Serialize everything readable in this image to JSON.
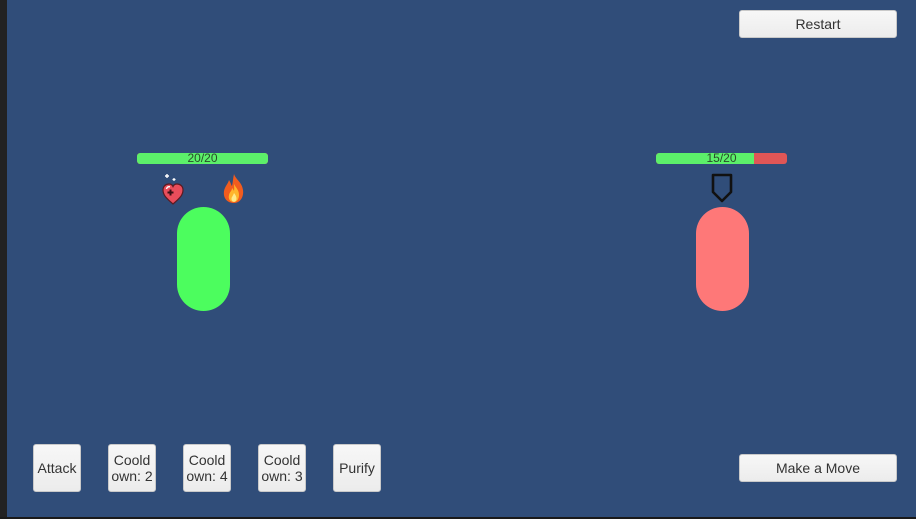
{
  "header": {
    "restart_label": "Restart"
  },
  "player": {
    "health_text": "20/20",
    "health_current": 20,
    "health_max": 20,
    "color": "#4cfd5e",
    "status_icons": [
      "heal-icon",
      "fire-icon"
    ]
  },
  "enemy": {
    "health_text": "15/20",
    "health_current": 15,
    "health_max": 20,
    "color": "#fe7878",
    "status_icons": [
      "shield-icon"
    ]
  },
  "actions": [
    {
      "label": "Attack"
    },
    {
      "label": "Cooldown: 2"
    },
    {
      "label": "Cooldown: 4"
    },
    {
      "label": "Cooldown: 3"
    },
    {
      "label": "Purify"
    }
  ],
  "footer": {
    "make_move_label": "Make a Move"
  },
  "colors": {
    "background": "#304d79",
    "health_fill": "#5cf06a",
    "health_empty": "#e05656"
  }
}
